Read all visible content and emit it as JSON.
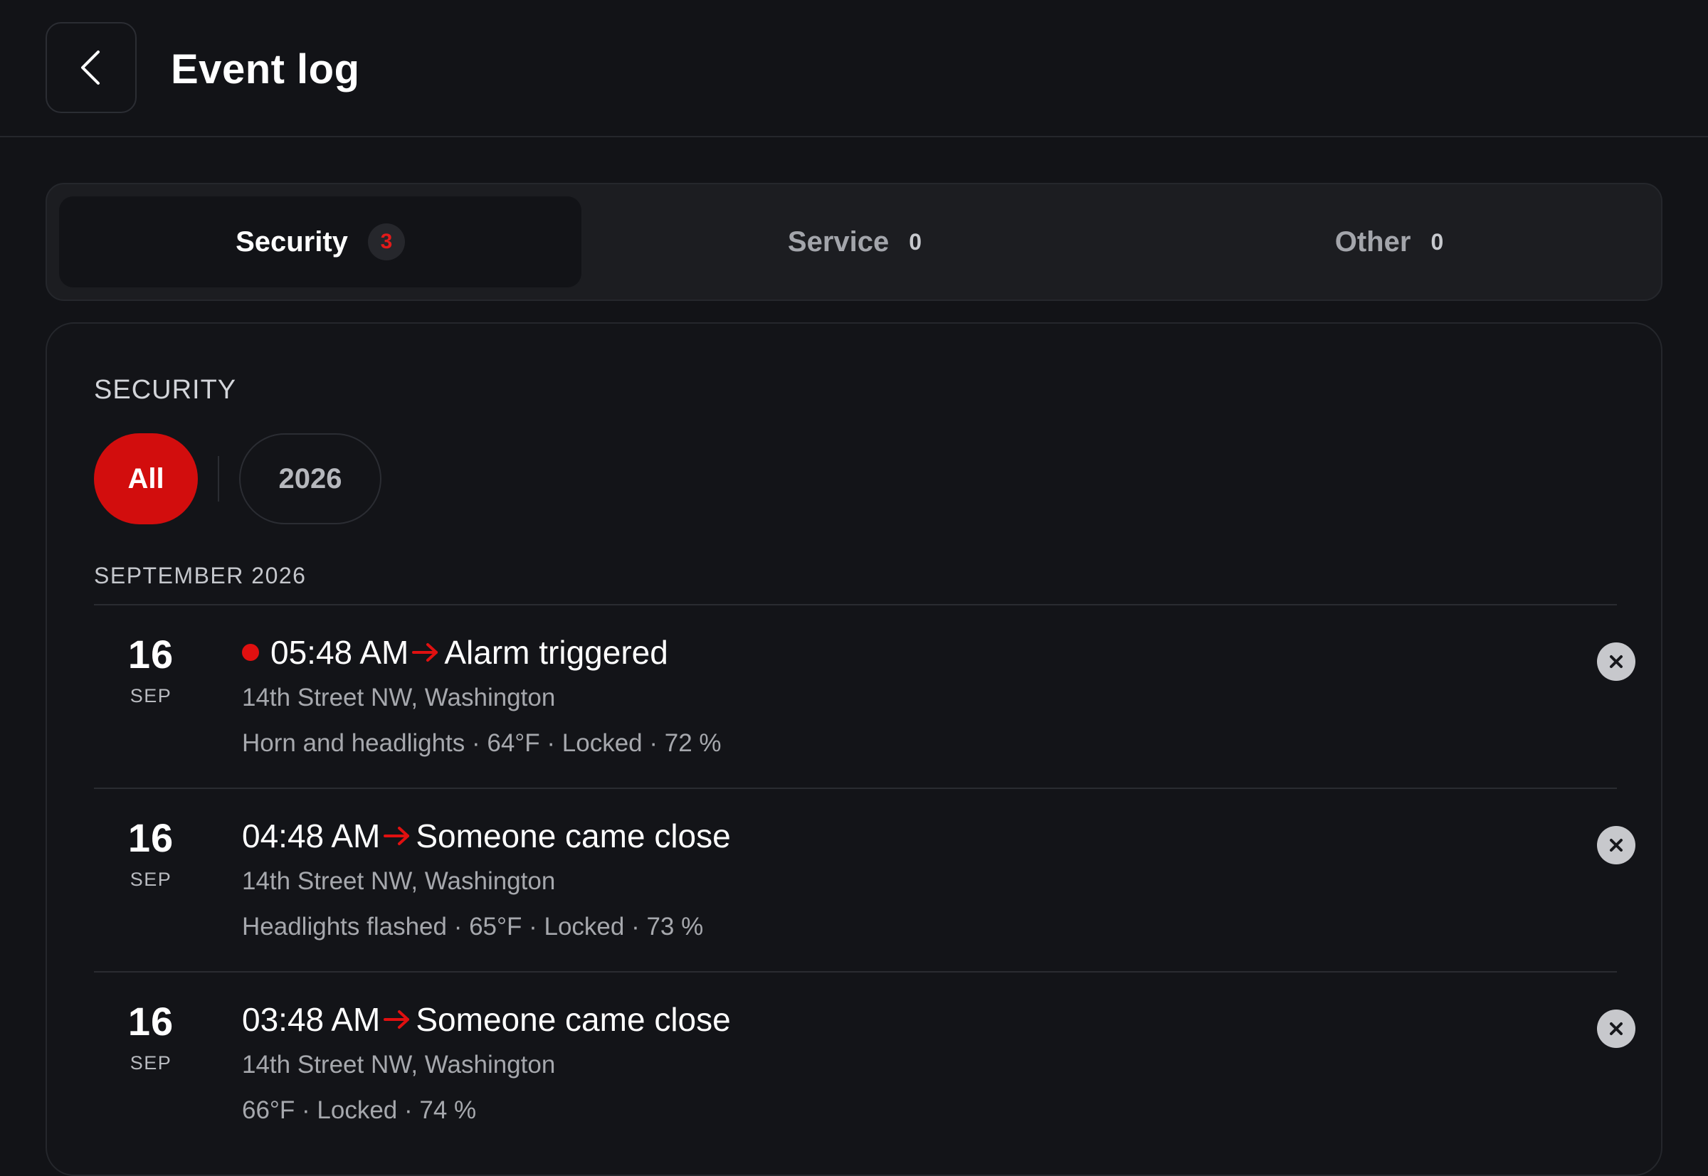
{
  "header": {
    "title": "Event log"
  },
  "tabs": [
    {
      "label": "Security",
      "count": "3",
      "active": true
    },
    {
      "label": "Service",
      "count": "0",
      "active": false
    },
    {
      "label": "Other",
      "count": "0",
      "active": false
    }
  ],
  "panel": {
    "section_title": "SECURITY",
    "filters": {
      "all_label": "All",
      "year_label": "2026",
      "selected": "All"
    },
    "month_label": "SEPTEMBER 2026"
  },
  "events": [
    {
      "day": "16",
      "month": "SEP",
      "time": "05:48 AM",
      "title": "Alarm triggered",
      "location": "14th Street NW, Washington",
      "details": "Horn and headlights · 64°F · Locked · 72 %",
      "unread": true
    },
    {
      "day": "16",
      "month": "SEP",
      "time": "04:48 AM",
      "title": "Someone came close",
      "location": "14th Street NW, Washington",
      "details": "Headlights flashed · 65°F · Locked · 73 %",
      "unread": false
    },
    {
      "day": "16",
      "month": "SEP",
      "time": "03:48 AM",
      "title": "Someone came close",
      "location": "14th Street NW, Washington",
      "details": "66°F · Locked · 74 %",
      "unread": false
    }
  ],
  "colors": {
    "accent": "#d20d0d",
    "background": "#121317",
    "surface": "#1c1d21"
  },
  "icons": {
    "back": "chevron-left-icon",
    "arrow": "arrow-right-icon",
    "dismiss": "close-icon"
  }
}
